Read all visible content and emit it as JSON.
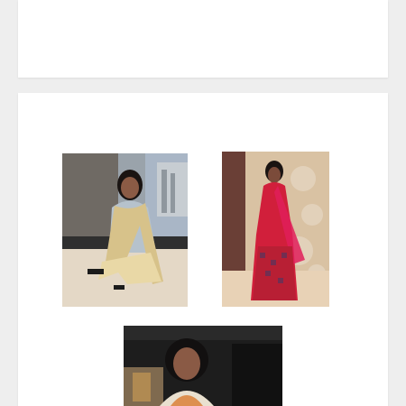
{
  "gallery": {
    "photos": [
      {
        "subject": "seated-woman-photo"
      },
      {
        "subject": "woman-in-red-dress-photo"
      },
      {
        "subject": "portrait-photo"
      }
    ]
  }
}
